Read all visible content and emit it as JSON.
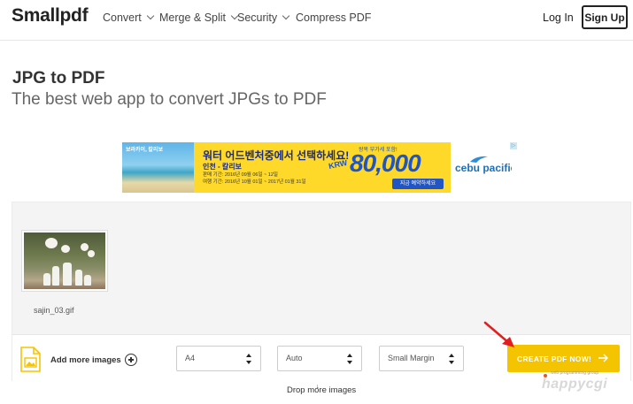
{
  "header": {
    "logo": "Smallpdf",
    "nav": [
      {
        "label": "Convert",
        "has_dropdown": true
      },
      {
        "label": "Merge & Split",
        "has_dropdown": true
      },
      {
        "label": "Security",
        "has_dropdown": true
      },
      {
        "label": "Compress PDF",
        "has_dropdown": false
      }
    ],
    "login": "Log In",
    "signup": "Sign Up"
  },
  "page": {
    "title": "JPG to PDF",
    "subtitle": "The best web app to convert JPGs to PDF"
  },
  "ad": {
    "photo_text": "보라카이, 칼리보",
    "headline": "워터 어드벤처중에서 선택하세요!",
    "route": "인천 - 칼리보",
    "dates": "판매 기간: 2016년 09월 06일 ~ 12일\n여행 기간: 2016년 10월 01일 ~ 2017년 01월 31일",
    "small_text": "왕복 부가세 포함!",
    "currency": "KRW",
    "price": "80,000",
    "cta": "지금 예약하세요",
    "brand": "cebu pacific",
    "choice_icon": "ad-choices-icon"
  },
  "workspace": {
    "files": [
      {
        "name": "sajin_03.gif"
      }
    ],
    "add_more_label": "Add more images",
    "page_size": "A4",
    "orientation": "Auto",
    "margin": "Small Margin",
    "create_button": "CREATE PDF NOW!",
    "drop_hint": "Drop more images"
  },
  "watermark": {
    "brand": "happycgi",
    "tagline": "web programming group"
  },
  "colors": {
    "accent": "#f5c400",
    "annotation_arrow": "#e02020",
    "ad_yellow": "#ffd92a",
    "ad_blue": "#2155c4"
  }
}
